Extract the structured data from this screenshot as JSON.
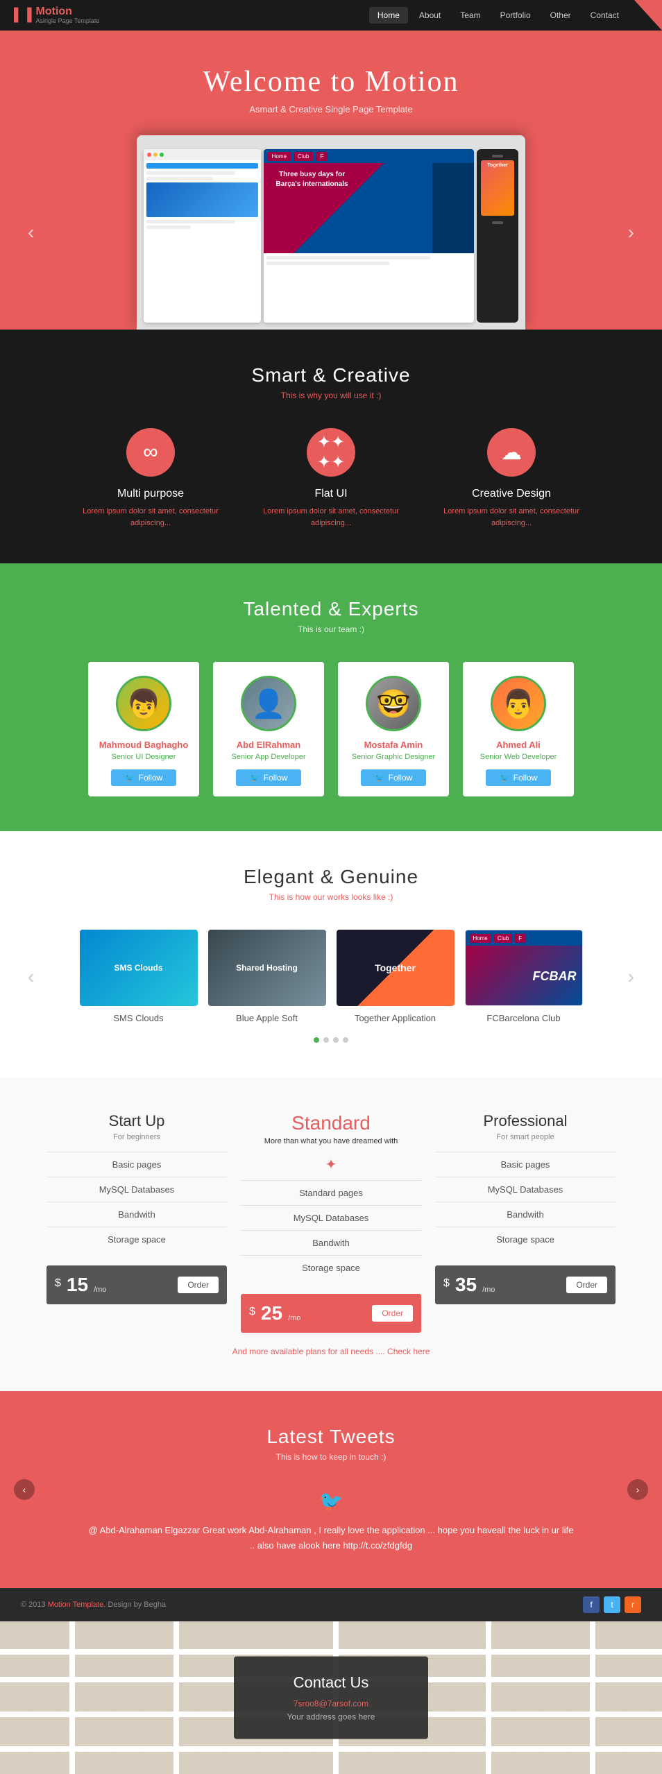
{
  "navbar": {
    "brand": "Motion",
    "brand_sub": "Asingle Page Template",
    "nav_items": [
      "Home",
      "About",
      "Team",
      "Portfolio",
      "Other",
      "Contact"
    ]
  },
  "hero": {
    "title": "Welcome to Motion",
    "subtitle": "Asmart & Creative Single Page Template",
    "arrow_left": "‹",
    "arrow_right": "›"
  },
  "features": {
    "section_title": "Smart & Creative",
    "section_subtitle": "This is why you will use it :)",
    "items": [
      {
        "name": "Multi purpose",
        "desc": "Lorem ipsum dolor sit amet, consectetur adipiscing...",
        "icon": "∞"
      },
      {
        "name": "Flat UI",
        "desc": "Lorem ipsum dolor sit amet, consectetur adipiscing...",
        "icon": "✦"
      },
      {
        "name": "Creative Design",
        "desc": "Lorem ipsum dolor sit amet, consectetur adipiscing...",
        "icon": "☁"
      }
    ]
  },
  "team": {
    "section_title": "Talented & Experts",
    "section_subtitle": "This is our team :)",
    "members": [
      {
        "name": "Mahmoud Baghagho",
        "role": "Senior UI Designer",
        "avatar_class": "a1",
        "emoji": "👦"
      },
      {
        "name": "Abd ElRahman",
        "role": "Senior App Developer",
        "avatar_class": "a2",
        "emoji": "👤"
      },
      {
        "name": "Mostafa Amin",
        "role": "Senior Graphic Designer",
        "avatar_class": "a3",
        "emoji": "👓"
      },
      {
        "name": "Ahmed Ali",
        "role": "Senior Web Developer",
        "avatar_class": "a4",
        "emoji": "👨"
      }
    ],
    "follow_label": "Follow"
  },
  "portfolio": {
    "section_title": "Elegant & Genuine",
    "section_subtitle": "This is how our works looks like :)",
    "items": [
      {
        "label": "SMS Clouds",
        "thumb_class": "p1"
      },
      {
        "label": "Blue Apple Soft",
        "thumb_class": "p2"
      },
      {
        "label": "Together Application",
        "thumb_class": "p3"
      },
      {
        "label": "FCBarcelona Club",
        "thumb_class": "p4"
      }
    ]
  },
  "pricing": {
    "plans": [
      {
        "name": "Start Up",
        "tagline": "For beginners",
        "featured": false,
        "features": [
          "Basic pages",
          "MySQL Databases",
          "Bandwith",
          "Storage space"
        ],
        "price": "15",
        "period": "/mo",
        "order_label": "Order"
      },
      {
        "name": "Standard",
        "tagline": "More than what you have dreamed with",
        "featured": true,
        "features": [
          "Standard pages",
          "MySQL Databases",
          "Bandwith",
          "Storage space"
        ],
        "price": "25",
        "period": "/mo",
        "order_label": "Order"
      },
      {
        "name": "Professional",
        "tagline": "For smart people",
        "featured": false,
        "features": [
          "Basic pages",
          "MySQL Databases",
          "Bandwith",
          "Storage space"
        ],
        "price": "35",
        "period": "/mo",
        "order_label": "Order"
      }
    ],
    "note": "And more available plans for all needs .... Check here"
  },
  "tweets": {
    "section_title": "Latest Tweets",
    "section_subtitle": "This is how to keep in touch :)",
    "tweet_text": "@ Abd-Alrahaman Elgazzar Great work Abd-Alrahaman , I really love the application ... hope you haveall the luck in ur life .. also have alook here http://t.co/zfdgfdg"
  },
  "footer": {
    "copyright": "© 2013 Motion Template. Design by Begha",
    "social": [
      "f",
      "t",
      "r"
    ]
  },
  "contact": {
    "title": "Contact Us",
    "email": "7sroo8@7arsof.com",
    "address": "Your address goes here"
  }
}
